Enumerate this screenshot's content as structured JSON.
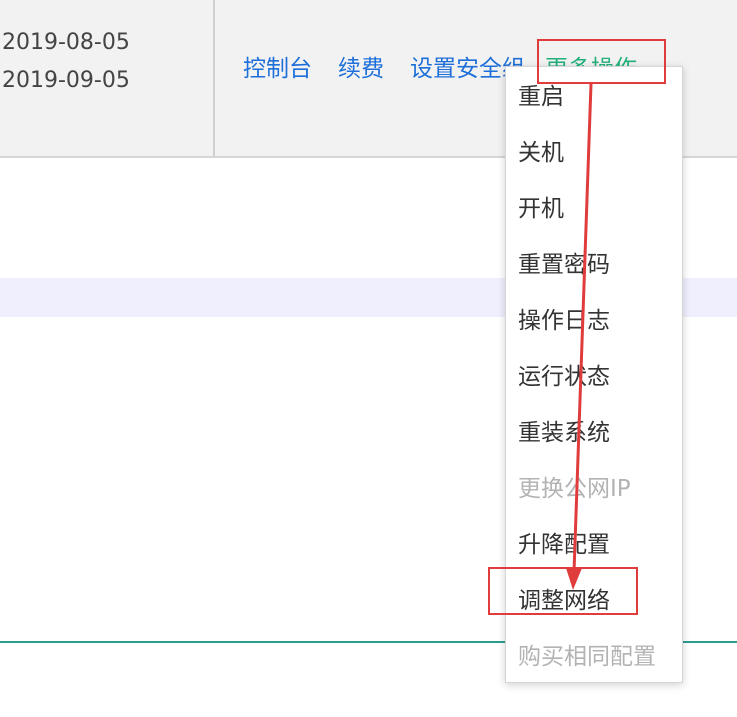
{
  "dates": {
    "start": "2019-08-05",
    "end": "2019-09-05"
  },
  "actions": {
    "console": "控制台",
    "renew": "续费",
    "security_group": "设置安全组",
    "more": "更多操作"
  },
  "menu": {
    "items": [
      {
        "label": "重启",
        "enabled": true
      },
      {
        "label": "关机",
        "enabled": true
      },
      {
        "label": "开机",
        "enabled": true
      },
      {
        "label": "重置密码",
        "enabled": true
      },
      {
        "label": "操作日志",
        "enabled": true
      },
      {
        "label": "运行状态",
        "enabled": true
      },
      {
        "label": "重装系统",
        "enabled": true
      },
      {
        "label": "更换公网IP",
        "enabled": false
      },
      {
        "label": "升降配置",
        "enabled": true
      },
      {
        "label": "调整网络",
        "enabled": true
      },
      {
        "label": "购买相同配置",
        "enabled": false
      }
    ]
  },
  "colors": {
    "link": "#1e6fd9",
    "more_link": "#21b07a",
    "annotation": "#e03c3c",
    "disabled_text": "#b3b3b3"
  }
}
